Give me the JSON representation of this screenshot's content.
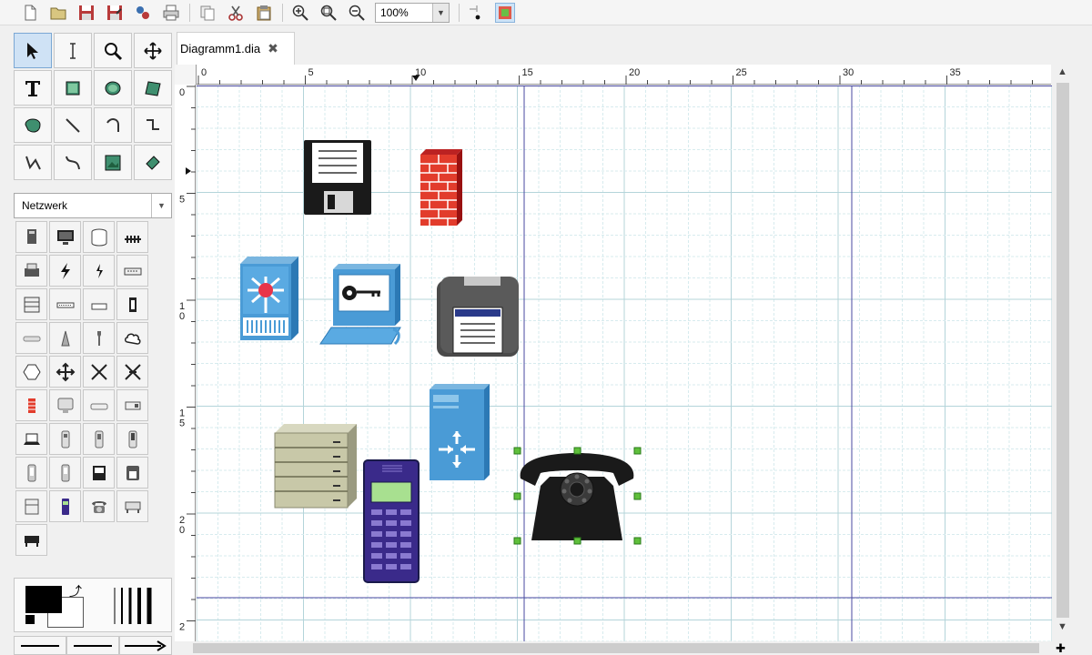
{
  "toolbar": {
    "zoom_value": "100%",
    "buttons": [
      "new-icon",
      "open-icon",
      "save-icon",
      "save-as-icon",
      "export-icon",
      "print-icon",
      "copy-icon",
      "cut-icon",
      "paste-icon",
      "zoom-in-icon",
      "zoom-fit-icon",
      "zoom-out-icon",
      "snap-grid-icon",
      "object-snap-icon"
    ]
  },
  "tools": [
    "pointer",
    "text-edit",
    "magnify",
    "scroll",
    "text",
    "box",
    "ellipse",
    "polygon",
    "beziergon",
    "line",
    "arc",
    "zigzag-line",
    "polyline",
    "bezier-line",
    "image",
    "outline"
  ],
  "sheet_selector": {
    "value": "Netzwerk"
  },
  "shapes": [
    "computer",
    "monitor",
    "disc-storage",
    "hub",
    "printer",
    "lightning",
    "lightning-small",
    "modem",
    "rack-server",
    "switch",
    "device-flat",
    "device-box",
    "network-flat",
    "antenna",
    "wrench",
    "cloud",
    "hexagon",
    "router-arrows",
    "crossing",
    "crossing-2",
    "firewall",
    "display",
    "flat-unit",
    "small-device",
    "laptop",
    "ups",
    "ups-2",
    "ups-3",
    "pda",
    "pda-2",
    "disk",
    "floppy-drive",
    "disk-box",
    "mobile-phone",
    "telephone",
    "printer-flat",
    "scanner"
  ],
  "tab": {
    "label": "Diagramm1.dia"
  },
  "hruler_labels": [
    "0",
    "5",
    "10",
    "15",
    "20",
    "25",
    "30",
    "35"
  ],
  "vruler_labels": [
    "0",
    "5",
    "1\n0",
    "1\n5",
    "2\n0",
    "2"
  ],
  "colors": {
    "grid": "#d7ebee",
    "grid_major": "#b4d4da",
    "guide": "#4a4aa0",
    "handle": "#5fbf3b"
  }
}
